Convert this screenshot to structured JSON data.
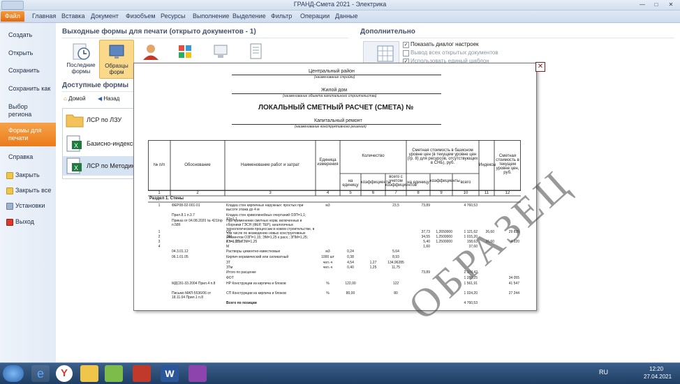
{
  "window": {
    "title": "ГРАНД-Смета 2021 - Электрика"
  },
  "ribbon": {
    "tabs": [
      "Файл",
      "Главная",
      "Вставка",
      "Документ",
      "Физобъем",
      "Ресурсы",
      "Выполнение",
      "Выделение",
      "Фильтр",
      "Операции",
      "Данные"
    ]
  },
  "left_menu": {
    "items": [
      "Создать",
      "Открыть",
      "Сохранить",
      "Сохранить как",
      "Выбор региона",
      "Формы для печати",
      "Справка"
    ],
    "actions": [
      "Закрыть",
      "Закрыть все",
      "Установки",
      "Выход"
    ]
  },
  "center": {
    "header": "Выходные формы для печати (открыто документов - 1)",
    "buttons": [
      "Последние формы",
      "Образцы форм"
    ],
    "available_header": "Доступные формы",
    "nav": {
      "home": "Домой",
      "back": "Назад"
    },
    "forms": [
      "ЛСР по ЛЗУ",
      "Базисно-индексный",
      "ЛСР по Методике 20"
    ]
  },
  "right": {
    "header": "Дополнительно",
    "options": [
      {
        "label": "Показать диалог настроек",
        "checked": true
      },
      {
        "label": "Вывод всех открытых документов",
        "checked": false
      },
      {
        "label": "Использовать единый шаблон",
        "checked": true
      }
    ]
  },
  "doc": {
    "region": "Центральный район",
    "region_note": "(наименование стройки)",
    "object": "Жилой дом",
    "object_note": "(наименование объекта капитального строительства)",
    "title": "ЛОКАЛЬНЫЙ СМЕТНЫЙ РАСЧЕТ (СМЕТА) №",
    "work": "Капитальный ремонт",
    "work_note": "(наименование конструктивного решения)",
    "stamp": "ОБРАЗЕЦ",
    "headers": {
      "np": "№ п/п",
      "basis": "Обоснование",
      "name": "Наименование работ и затрат",
      "unit": "Единица измерения",
      "qty": "Количество",
      "per_unit": "на единицу",
      "coef": "коэффициенты",
      "total_coef": "всего с учетом коэффициентов",
      "base_cost": "Сметная стоимость в базисном уровне цен (в текущем уровне цен (гр. 8) для ресурсов, отсутствующих в СНБ), руб.",
      "per_unit2": "на единицу",
      "coef2": "коэффициенты",
      "total": "всего",
      "index": "Индексы",
      "current_cost": "Сметная стоимость в текущем уровне цен, руб."
    },
    "col_numbers": [
      "1",
      "2",
      "3",
      "4",
      "5",
      "6",
      "7",
      "8",
      "9",
      "10",
      "11",
      "12"
    ],
    "section": "Раздел 1. Стены",
    "rows": [
      {
        "n": "1",
        "basis": "ФЕР08-02-001-01",
        "name": "Кладка стен кирпичных наружных: простых при высоте этажа до 4 м",
        "unit": "м3",
        "qty": "",
        "total_qty": "23,5",
        "pu": "73,89",
        "coef": "",
        "tot": "4 760,53",
        "idx": "",
        "cur": ""
      },
      {
        "n": "",
        "basis": "Прил.8.1 п.3.7",
        "name": "Кладка стен криволинейных очертаний ОЗП=1,1; ТЗ=1,1",
        "unit": "",
        "qty": "",
        "total_qty": "",
        "pu": "",
        "coef": "",
        "tot": "",
        "idx": "",
        "cur": ""
      },
      {
        "n": "",
        "basis": "Приказ от 04.08.2020 № 421/пр п.58б",
        "name": "При применении сметных норм, включенных в сборники ГЭСН (ФЕР, ТЕР), аналогичных технологическим процессам в новом строительстве, в том числе по возведению новых конструктивных элементов ОЗП=1,15; ЭМ=1,25 к расх.; ЗПМ=1,25; ТЗ=1,15; ТЗМ=1,25",
        "unit": "",
        "qty": "",
        "total_qty": "",
        "pu": "",
        "coef": "",
        "tot": "",
        "idx": "",
        "cur": ""
      },
      {
        "n": "1",
        "basis": "",
        "name": "ОТ",
        "unit": "",
        "qty": "",
        "total_qty": "",
        "pu": "37,73",
        "coef": "1,2650000",
        "tot": "1 121,62",
        "idx": "26,60",
        "cur": "29 835"
      },
      {
        "n": "2",
        "basis": "",
        "name": "ЭМ",
        "unit": "",
        "qty": "",
        "total_qty": "",
        "pu": "34,55",
        "coef": "1,2500000",
        "tot": "1 015,20",
        "idx": "",
        "cur": ""
      },
      {
        "n": "3",
        "basis": "",
        "name": "в т.ч. ОТм",
        "unit": "",
        "qty": "",
        "total_qty": "",
        "pu": "5,40",
        "coef": "1,2500000",
        "tot": "158,63",
        "idx": "26,60",
        "cur": "4 220"
      },
      {
        "n": "4",
        "basis": "",
        "name": "М",
        "unit": "",
        "qty": "",
        "total_qty": "",
        "pu": "1,60",
        "coef": "",
        "tot": "37,60",
        "idx": "",
        "cur": ""
      },
      {
        "n": "",
        "basis": "04.3.01.12",
        "name": "Растворы цементно-известковые",
        "unit": "м3",
        "qty": "0,24",
        "total_qty": "5,64",
        "pu": "",
        "coef": "",
        "tot": "",
        "idx": "",
        "cur": ""
      },
      {
        "n": "",
        "basis": "06.1.01.05",
        "name": "Кирпич керамический или силикатный",
        "unit": "1000 шт",
        "qty": "0,38",
        "total_qty": "8,93",
        "pu": "",
        "coef": "",
        "tot": "",
        "idx": "",
        "cur": ""
      },
      {
        "n": "",
        "basis": "",
        "name": "ЗТ",
        "unit": "чел.-ч",
        "qty": "4,54",
        "coef1": "1,27",
        "total_qty": "134,96285",
        "pu": "",
        "coef": "",
        "tot": "",
        "idx": "",
        "cur": ""
      },
      {
        "n": "",
        "basis": "",
        "name": "ЗТм",
        "unit": "чел.-ч",
        "qty": "0,40",
        "coef1": "1,25",
        "total_qty": "11,75",
        "pu": "",
        "coef": "",
        "tot": "",
        "idx": "",
        "cur": ""
      },
      {
        "n": "",
        "basis": "",
        "name": "Итого по расценке",
        "unit": "",
        "qty": "",
        "total_qty": "",
        "pu": "73,89",
        "coef": "",
        "tot": "2 174,42",
        "idx": "",
        "cur": ""
      },
      {
        "n": "",
        "basis": "",
        "name": "ФОТ",
        "unit": "",
        "qty": "",
        "total_qty": "",
        "pu": "",
        "coef": "",
        "tot": "1 280,25",
        "idx": "",
        "cur": "34 055"
      },
      {
        "n": "",
        "basis": "МДС81-33.2004 Прил.4 п.8",
        "name": "НР Конструкции из кирпича и блоков",
        "unit": "%",
        "qty": "122,00",
        "total_qty": "122",
        "pu": "",
        "coef": "",
        "tot": "1 561,91",
        "idx": "",
        "cur": "41 547"
      },
      {
        "n": "",
        "basis": "Письмо МАП-5536/06 от 18.11.04 Прил.1 п.8",
        "name": "СП Конструкции из кирпича и блоков",
        "unit": "%",
        "qty": "80,00",
        "total_qty": "80",
        "pu": "",
        "coef": "",
        "tot": "1 024,20",
        "idx": "",
        "cur": "27 244"
      },
      {
        "n": "",
        "basis": "",
        "name": "Всего по позиции",
        "unit": "",
        "qty": "",
        "total_qty": "",
        "pu": "",
        "coef": "",
        "tot": "4 760,53",
        "idx": "",
        "cur": ""
      }
    ]
  },
  "taskbar": {
    "lang": "RU",
    "time": "12:20",
    "date": "27.04.2021"
  },
  "colors": {
    "accent": "#e8761a",
    "ribbon": "#cfdcee"
  }
}
